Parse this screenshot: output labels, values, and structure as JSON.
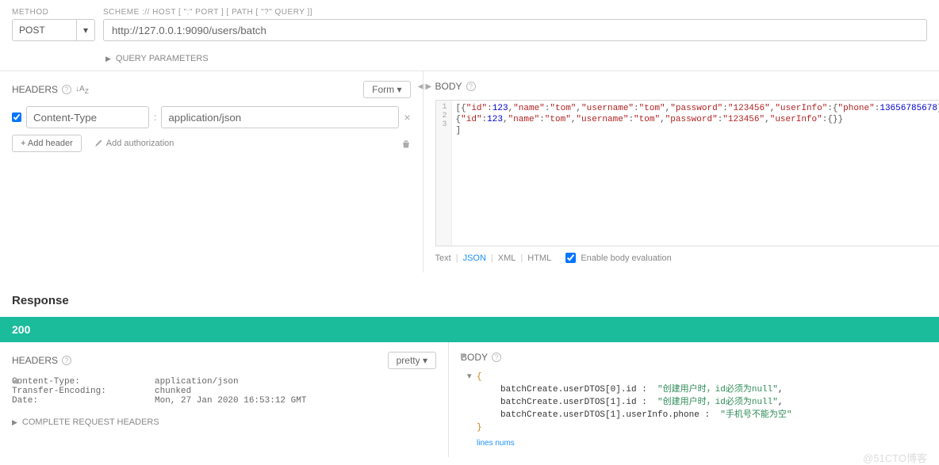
{
  "request": {
    "method_label": "METHOD",
    "method_value": "POST",
    "url_label": "SCHEME :// HOST [ \":\" PORT ] [ PATH [ \"?\" QUERY ]]",
    "url_value": "http://127.0.0.1:9090/users/batch",
    "query_params_label": "QUERY PARAMETERS"
  },
  "req_headers": {
    "title": "HEADERS",
    "form_btn": "Form",
    "row": {
      "name": "Content-Type",
      "value": "application/json"
    },
    "add_header": "+ Add header",
    "add_auth": "Add authorization"
  },
  "req_body": {
    "title": "BODY",
    "line1_parts": [
      "[{",
      "\"id\"",
      ":",
      "123",
      ",",
      "\"name\"",
      ":",
      "\"tom\"",
      ",",
      "\"username\"",
      ":",
      "\"tom\"",
      ",",
      "\"password\"",
      ":",
      "\"123456\"",
      ",",
      "\"userInfo\"",
      ":{",
      "\"phone\"",
      ":",
      "13656785678",
      "}},"
    ],
    "line2_parts": [
      "{",
      "\"id\"",
      ":",
      "123",
      ",",
      "\"name\"",
      ":",
      "\"tom\"",
      ",",
      "\"username\"",
      ":",
      "\"tom\"",
      ",",
      "\"password\"",
      ":",
      "\"123456\"",
      ",",
      "\"userInfo\"",
      ":{}}"
    ],
    "line3": "]",
    "footer": {
      "text": "Text",
      "json": "JSON",
      "xml": "XML",
      "html": "HTML",
      "enable": "Enable body evaluation"
    }
  },
  "response": {
    "title": "Response",
    "status": "200",
    "headers_title": "HEADERS",
    "pretty_btn": "pretty",
    "headers": [
      {
        "name": "Content-Type:",
        "value": "application/json"
      },
      {
        "name": "Transfer-Encoding:",
        "value": "chunked"
      },
      {
        "name": "Date:",
        "value": "Mon, 27 Jan 2020 16:53:12 GMT"
      }
    ],
    "complete_headers": "COMPLETE REQUEST HEADERS",
    "body_title": "BODY",
    "json_lines": [
      {
        "key": "batchCreate.userDTOS[0].id  :",
        "value": "\"创建用户时，id必须为null\"",
        "comma": ","
      },
      {
        "key": "batchCreate.userDTOS[1].id  :",
        "value": "\"创建用户时，id必须为null\"",
        "comma": ","
      },
      {
        "key": "batchCreate.userDTOS[1].userInfo.phone  :",
        "value": "\"手机号不能为空\"",
        "comma": ""
      }
    ],
    "lines_nums": "lines nums"
  },
  "watermark": "@51CTO博客"
}
